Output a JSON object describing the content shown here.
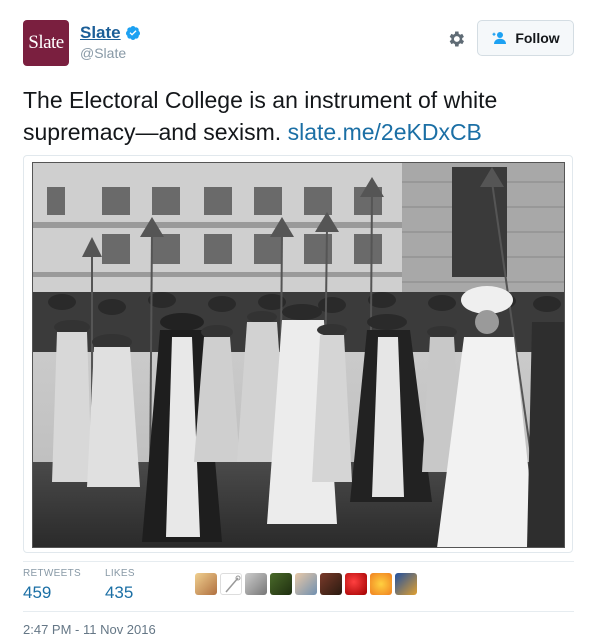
{
  "account": {
    "avatar_text": "Slate",
    "display_name": "Slate",
    "handle": "@Slate",
    "verified_icon": "verified-badge-icon",
    "brand_color": "#7a1f3f"
  },
  "actions": {
    "settings_icon": "gear-icon",
    "follow_icon": "add-user-icon",
    "follow_label": "Follow"
  },
  "tweet": {
    "text": "The Electoral College is an instrument of white supremacy—and sexism.",
    "link": "slate.me/2eKDxCB",
    "link_color": "#1b6fa5"
  },
  "stats": {
    "retweets_label": "RETWEETS",
    "retweets_value": "459",
    "likes_label": "LIKES",
    "likes_value": "435"
  },
  "likers": [
    "avatar-1",
    "avatar-2",
    "avatar-3",
    "avatar-4",
    "avatar-5",
    "avatar-6",
    "avatar-7",
    "avatar-8",
    "avatar-9"
  ],
  "timestamp": "2:47 PM - 11 Nov 2016"
}
